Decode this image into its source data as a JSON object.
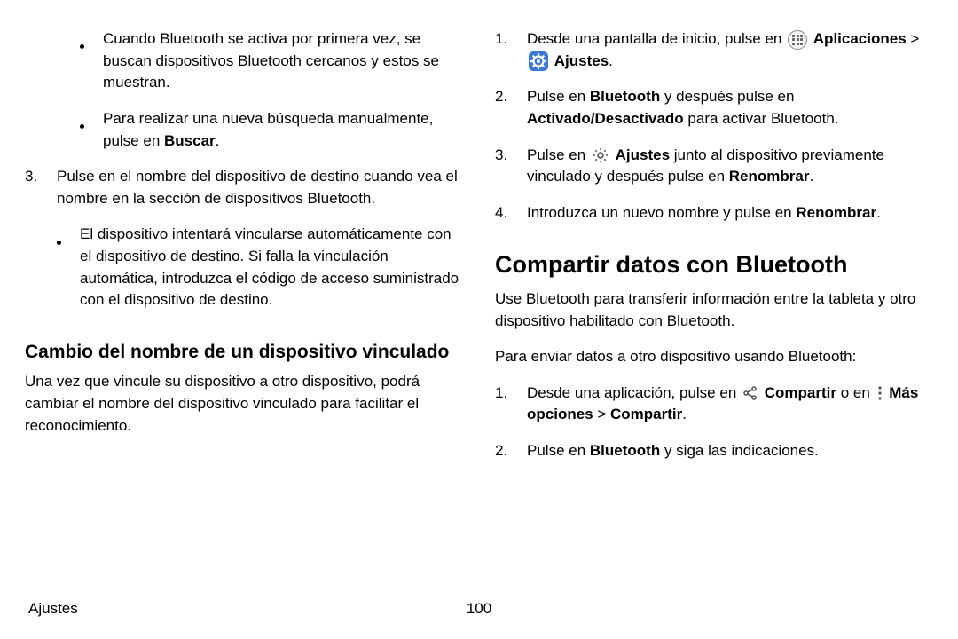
{
  "footer": {
    "section": "Ajustes",
    "page": "100"
  },
  "left": {
    "bullets_top": [
      {
        "pre": "Cuando Bluetooth se activa por primera vez, se buscan dispositivos Bluetooth cercanos y estos se muestran."
      },
      {
        "pre": "Para realizar una nueva búsqueda manualmente, pulse en ",
        "bold": "Buscar",
        "post": "."
      }
    ],
    "step3_num": "3.",
    "step3_text": "Pulse en el nombre del dispositivo de destino cuando vea el nombre en la sección de dispositivos Bluetooth.",
    "step3_sub": "El dispositivo intentará vincularse automáticamente con el dispositivo de destino. Si falla la vinculación automática, introduzca el código de acceso suministrado con el dispositivo de destino.",
    "h3": "Cambio del nombre de un dispositivo vinculado",
    "h3_para": "Una vez que vincule su dispositivo a otro dispositivo, podrá cambiar el nombre del dispositivo vinculado para facilitar el reconocimiento."
  },
  "right": {
    "step1_num": "1.",
    "step1_pre": "Desde una pantalla de inicio, pulse en ",
    "step1_apps": "Aplicaciones",
    "step1_sep": " > ",
    "step1_settings": "Ajustes",
    "step1_post": ".",
    "step2_num": "2.",
    "step2_a": "Pulse en ",
    "step2_b": "Bluetooth",
    "step2_c": " y después pulse en ",
    "step2_d": "Activado/Desactivado",
    "step2_e": " para activar Bluetooth.",
    "step3_num": "3.",
    "step3_a": "Pulse en ",
    "step3_b": "Ajustes",
    "step3_c": " junto al dispositivo previamente vinculado y después pulse en ",
    "step3_d": "Renombrar",
    "step3_e": ".",
    "step4_num": "4.",
    "step4_a": "Introduzca un nuevo nombre y pulse en ",
    "step4_b": "Renombrar",
    "step4_c": ".",
    "h2": "Compartir datos con Bluetooth",
    "h2_para1": "Use Bluetooth para transferir información entre la tableta y otro dispositivo habilitado con Bluetooth.",
    "h2_para2": "Para enviar datos a otro dispositivo usando Bluetooth:",
    "s1_num": "1.",
    "s1_a": "Desde una aplicación, pulse en ",
    "s1_b": "Compartir",
    "s1_c": " o en ",
    "s1_d": "Más opciones",
    "s1_e": " > ",
    "s1_f": "Compartir",
    "s1_g": ".",
    "s2_num": "2.",
    "s2_a": "Pulse en ",
    "s2_b": "Bluetooth",
    "s2_c": " y siga las indicaciones."
  }
}
